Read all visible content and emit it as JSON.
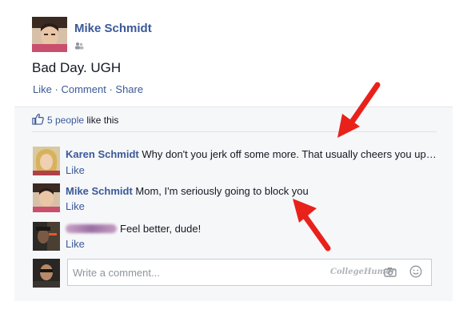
{
  "post": {
    "author": "Mike Schmidt",
    "status": "Bad Day. UGH",
    "actions": {
      "like": "Like",
      "comment": "Comment",
      "share": "Share",
      "sep": "·"
    }
  },
  "likes": {
    "count": "5 people",
    "suffix": "like this"
  },
  "comments": [
    {
      "author": "Karen Schmidt",
      "text": "Why don't you jerk off some more. That usually cheers you up…",
      "like": "Like"
    },
    {
      "author": "Mike Schmidt",
      "text": "Mom, I'm seriously going to block you",
      "like": "Like"
    },
    {
      "author": "",
      "text": "Feel better, dude!",
      "like": "Like"
    }
  ],
  "composer": {
    "placeholder": "Write a comment...",
    "watermark": "CollegeHumor"
  },
  "icons": {
    "friends": "friends-icon",
    "thumb": "thumbs-up-icon",
    "camera": "camera-icon",
    "emoji": "smiley-icon",
    "arrow": "red-arrow-icon"
  },
  "colors": {
    "link": "#3b5998",
    "arrow": "#e8221b",
    "ufi_bg": "#f6f7f9"
  }
}
